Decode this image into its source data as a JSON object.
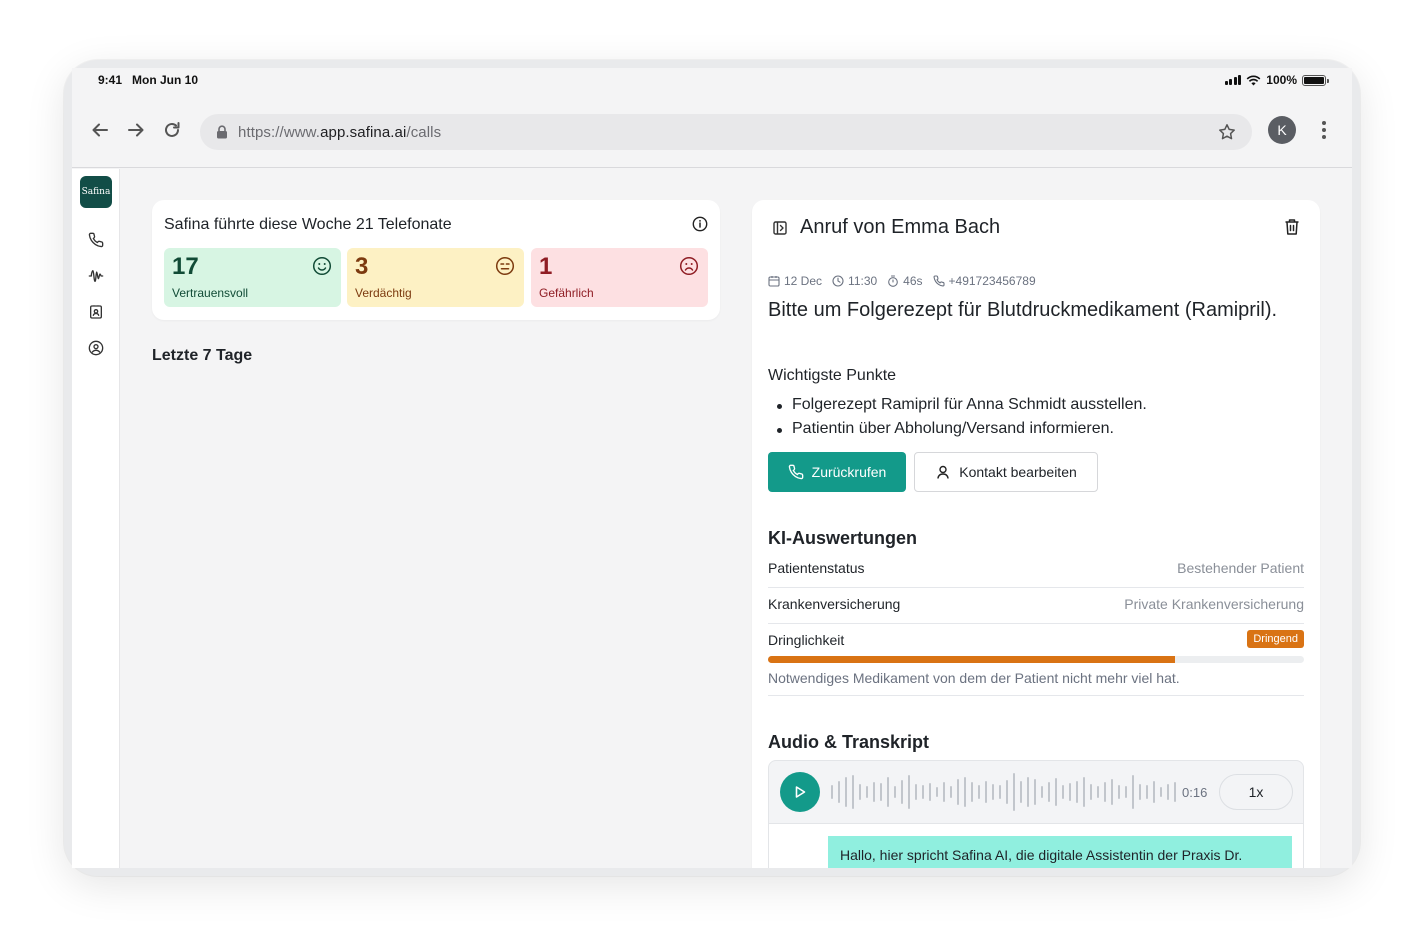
{
  "status_bar": {
    "time": "9:41",
    "date": "Mon Jun 10",
    "battery": "100%"
  },
  "browser": {
    "url_prefix": "https://www.",
    "url_host": "app.safina.ai",
    "url_path": "/calls",
    "profile_initial": "K"
  },
  "sidebar": {
    "logo": "Safina",
    "items": [
      {
        "icon": "phone-icon"
      },
      {
        "icon": "waveform-icon"
      },
      {
        "icon": "contact-card-icon"
      },
      {
        "icon": "user-circle-icon"
      }
    ]
  },
  "stats": {
    "headline": "Safina führte diese Woche 21 Telefonate",
    "tiles": [
      {
        "value": "17",
        "label": "Vertrauensvoll",
        "icon": "smile-icon",
        "color": "#d7f5e3"
      },
      {
        "value": "3",
        "label": "Verdächtig",
        "icon": "neutral-face-icon",
        "color": "#fdf1c4"
      },
      {
        "value": "1",
        "label": "Gefährlich",
        "icon": "frown-icon",
        "color": "#fde0e2"
      }
    ]
  },
  "last_days_label": "Letzte 7 Tage",
  "call": {
    "title": "Anruf von Emma Bach",
    "date": "12 Dec",
    "time": "11:30",
    "duration": "46s",
    "phone": "+491723456789",
    "summary": "Bitte um Folgerezept für Blutdruckmedikament (Ramipril).",
    "key_points_title": "Wichtigste Punkte",
    "key_points": [
      "Folgerezept Ramipril für Anna Schmidt ausstellen.",
      "Patientin über Abholung/Versand informieren."
    ],
    "callback_label": "Zurückrufen",
    "edit_contact_label": "Kontakt bearbeiten"
  },
  "ki": {
    "title": "KI-Auswertungen",
    "patient_status_key": "Patientenstatus",
    "patient_status_value": "Bestehender Patient",
    "insurance_key": "Krankenversicherung",
    "insurance_value": "Private Krankenversicherung",
    "urgency_key": "Dringlichkeit",
    "urgency_badge": "Dringend",
    "urgency_level": 0.76,
    "urgency_note": "Notwendiges Medikament von dem der Patient nicht mehr viel hat.",
    "accent_color": "#d97314"
  },
  "audio": {
    "title": "Audio & Transkript",
    "duration": "0:16",
    "speed": "1x",
    "transcript_first": "Hallo, hier spricht Safina AI, die digitale Assistentin der Praxis Dr. Musterfrau. Wie kann ich Ihnen helfen?"
  },
  "colors": {
    "brand": "#139a8a",
    "logo_bg": "#124d47"
  }
}
